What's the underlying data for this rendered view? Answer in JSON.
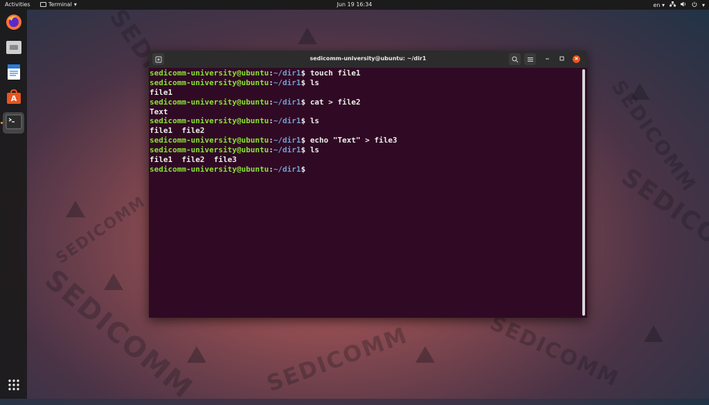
{
  "topbar": {
    "activities": "Activities",
    "app_name": "Terminal",
    "clock": "Jun 19  16:34",
    "language": "en"
  },
  "dock": {
    "items": [
      {
        "name": "firefox-icon"
      },
      {
        "name": "files-icon"
      },
      {
        "name": "writer-icon"
      },
      {
        "name": "software-icon"
      },
      {
        "name": "terminal-icon"
      }
    ]
  },
  "window": {
    "title": "sedicomm-university@ubuntu: ~/dir1"
  },
  "terminal": {
    "lines": [
      {
        "user": "sedicomm-university@ubuntu",
        "path": "~/dir1",
        "cmd": "touch file1"
      },
      {
        "user": "sedicomm-university@ubuntu",
        "path": "~/dir1",
        "cmd": "ls"
      },
      {
        "out": "file1"
      },
      {
        "user": "sedicomm-university@ubuntu",
        "path": "~/dir1",
        "cmd": "cat > file2"
      },
      {
        "out": "Text"
      },
      {
        "user": "sedicomm-university@ubuntu",
        "path": "~/dir1",
        "cmd": "ls"
      },
      {
        "out": "file1  file2"
      },
      {
        "user": "sedicomm-university@ubuntu",
        "path": "~/dir1",
        "cmd": "echo \"Text\" > file3"
      },
      {
        "user": "sedicomm-university@ubuntu",
        "path": "~/dir1",
        "cmd": "ls"
      },
      {
        "out": "file1  file2  file3"
      },
      {
        "user": "sedicomm-university@ubuntu",
        "path": "~/dir1",
        "cmd": ""
      }
    ]
  },
  "wallpaper": {
    "watermark": "SEDICOMM"
  },
  "colors": {
    "terminal_bg": "#300a24",
    "prompt_user": "#8ae234",
    "prompt_path": "#729fcf",
    "close_button": "#e95420"
  }
}
